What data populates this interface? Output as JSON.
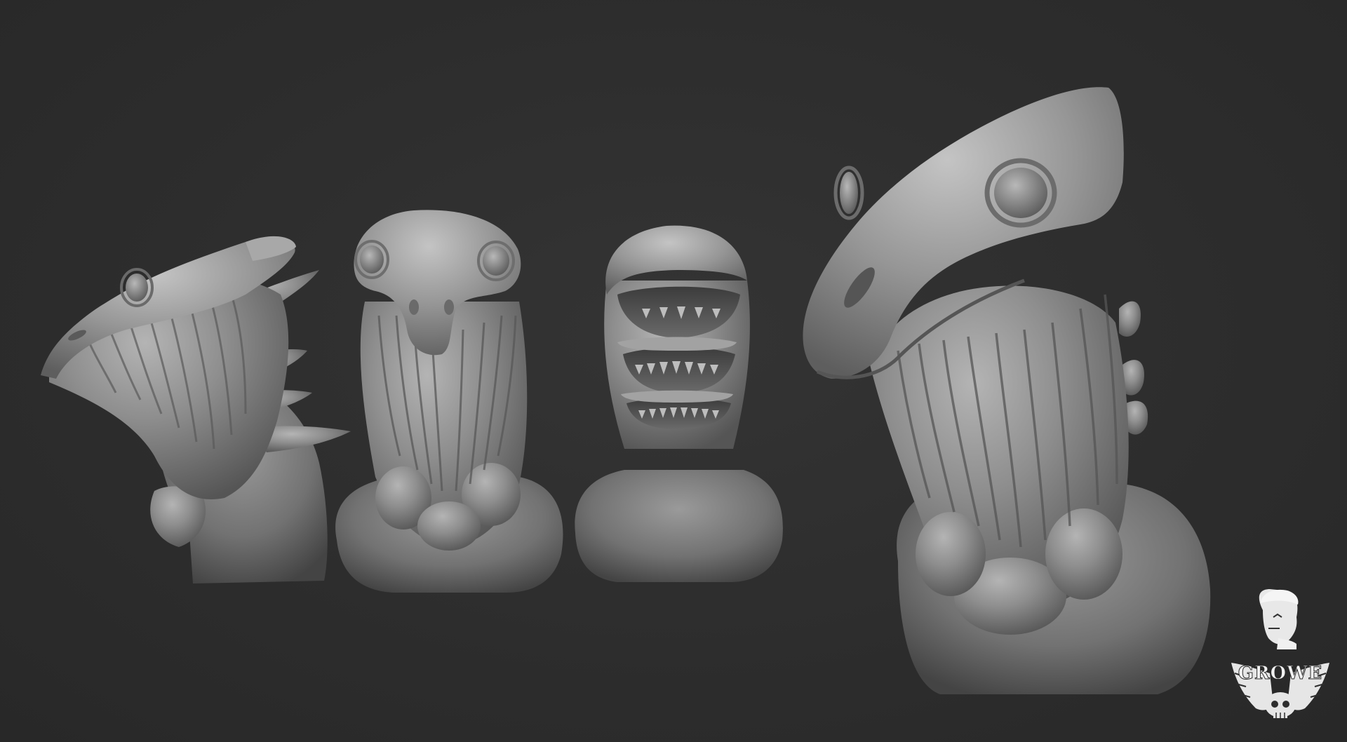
{
  "scene": {
    "background_color": "#2e2e2e",
    "clay_color": "#8a8a8a",
    "views": [
      {
        "name": "side-profile-view"
      },
      {
        "name": "front-view"
      },
      {
        "name": "back-view"
      },
      {
        "name": "three-quarter-closeup-view"
      }
    ]
  },
  "logo": {
    "text": "GROWE",
    "icon": "skull-with-wings-icon"
  }
}
